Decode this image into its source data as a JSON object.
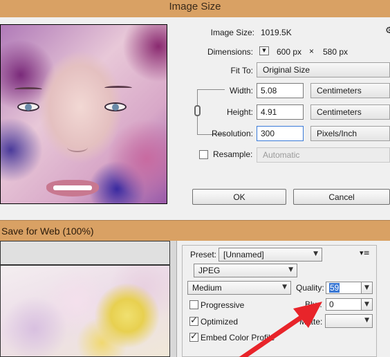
{
  "image_size": {
    "title": "Image Size",
    "image_size_label": "Image Size:",
    "image_size_value": "1019.5K",
    "gear_glyph": "⚙",
    "dimensions_label": "Dimensions:",
    "dimensions_width": "600 px",
    "dimensions_times": "×",
    "dimensions_height": "580 px",
    "fit_to_label": "Fit To:",
    "fit_to_value": "Original Size",
    "width_label": "Width:",
    "width_value": "5.08",
    "width_unit": "Centimeters",
    "height_label": "Height:",
    "height_value": "4.91",
    "height_unit": "Centimeters",
    "resolution_label": "Resolution:",
    "resolution_value": "300",
    "resolution_unit": "Pixels/Inch",
    "resample_label": "Resample:",
    "resample_value": "Automatic",
    "resample_checked": false,
    "ok_label": "OK",
    "cancel_label": "Cancel"
  },
  "save_for_web": {
    "title": "Save for Web (100%)",
    "preset_label": "Preset:",
    "preset_value": "[Unnamed]",
    "menu_icon": "▾≡",
    "format_value": "JPEG",
    "quality_level_value": "Medium",
    "quality_label": "Quality:",
    "quality_value": "59",
    "progressive_label": "Progressive",
    "progressive_checked": false,
    "blur_label": "Blur:",
    "blur_value": "0",
    "optimized_label": "Optimized",
    "optimized_checked": true,
    "matte_label": "Matte:",
    "matte_value": "",
    "embed_profile_label": "Embed Color Profile",
    "embed_profile_checked": true
  },
  "annotation": {
    "arrow_color": "#e8242a"
  },
  "icons": {
    "chain_link": "chain-link-icon",
    "dropdown": "chevron-down-icon",
    "panel_menu": "panel-menu-icon"
  }
}
